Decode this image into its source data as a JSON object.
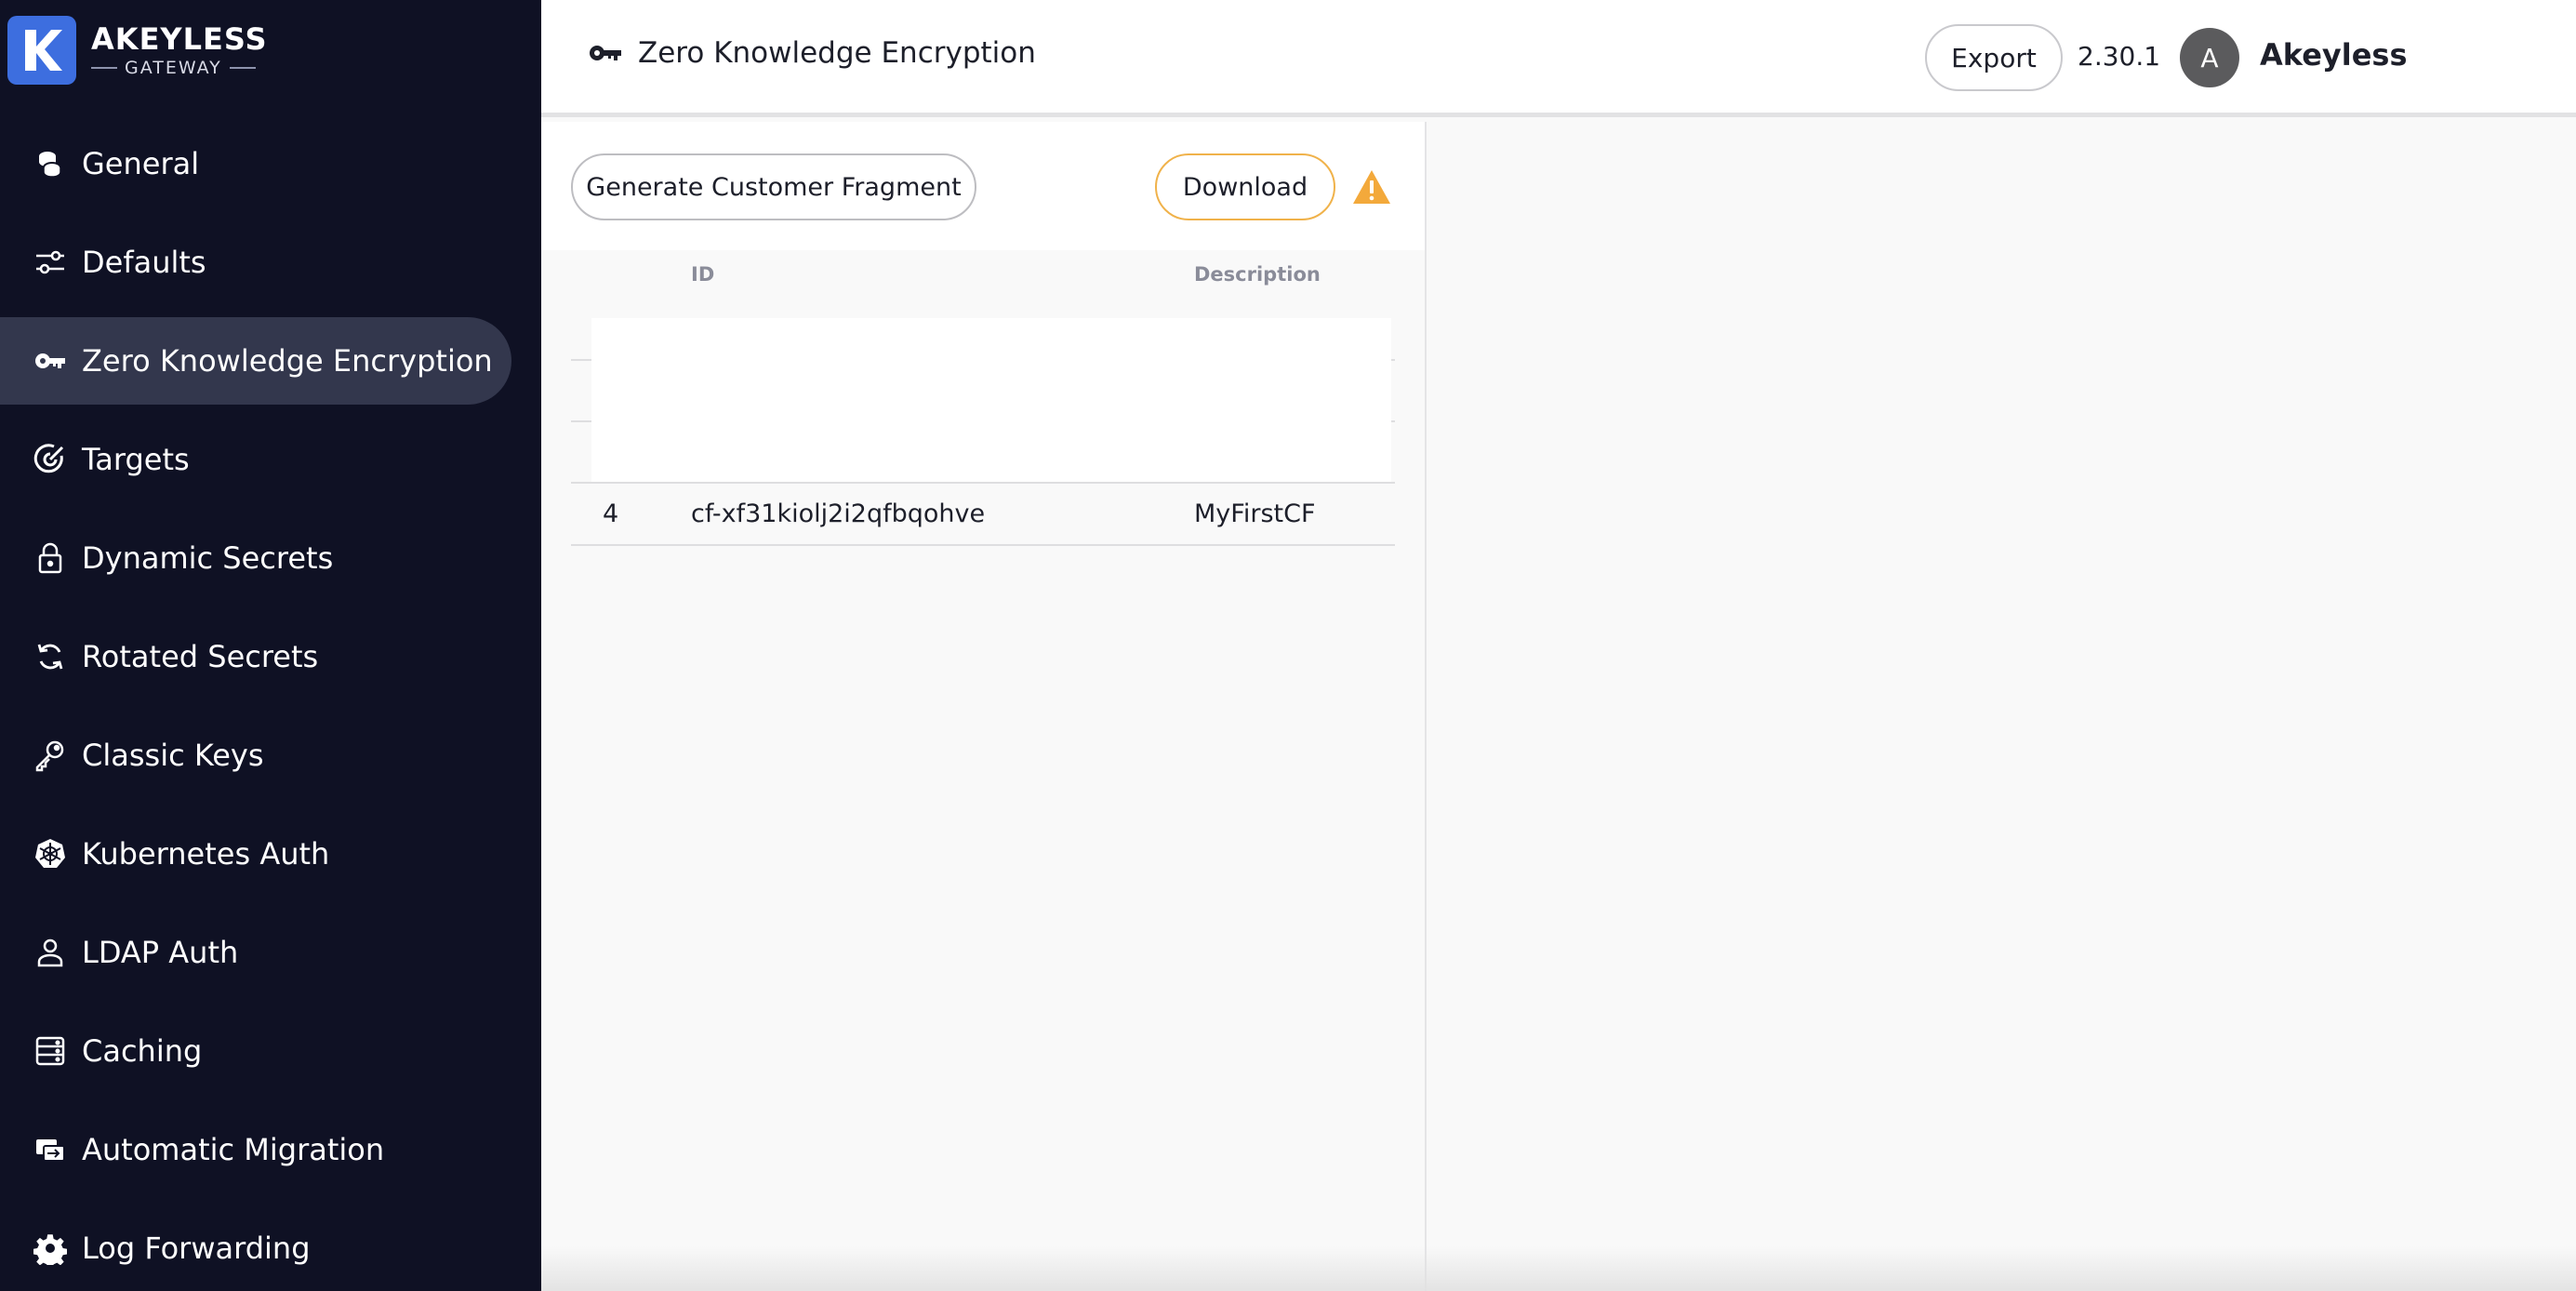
{
  "brand": {
    "name": "AKEYLESS",
    "sub": "GATEWAY",
    "logo_letter": "K"
  },
  "sidebar": {
    "items": [
      {
        "label": "General",
        "icon": "coins-icon",
        "active": false
      },
      {
        "label": "Defaults",
        "icon": "sliders-icon",
        "active": false
      },
      {
        "label": "Zero Knowledge Encryption",
        "icon": "key-icon",
        "active": true
      },
      {
        "label": "Targets",
        "icon": "target-icon",
        "active": false
      },
      {
        "label": "Dynamic Secrets",
        "icon": "lock-icon",
        "active": false
      },
      {
        "label": "Rotated Secrets",
        "icon": "rotate-icon",
        "active": false
      },
      {
        "label": "Classic Keys",
        "icon": "classic-key-icon",
        "active": false
      },
      {
        "label": "Kubernetes Auth",
        "icon": "kubernetes-icon",
        "active": false
      },
      {
        "label": "LDAP Auth",
        "icon": "user-icon",
        "active": false
      },
      {
        "label": "Caching",
        "icon": "server-icon",
        "active": false
      },
      {
        "label": "Automatic Migration",
        "icon": "migration-icon",
        "active": false
      },
      {
        "label": "Log Forwarding",
        "icon": "gear-icon",
        "active": false
      }
    ]
  },
  "header": {
    "title": "Zero Knowledge Encryption",
    "export_label": "Export",
    "version": "2.30.1",
    "avatar_letter": "A",
    "username": "Akeyless"
  },
  "toolbar": {
    "generate_label": "Generate Customer Fragment",
    "download_label": "Download"
  },
  "table": {
    "columns": [
      "ID",
      "Description"
    ],
    "rows": [
      {
        "index": "4",
        "id": "cf-xf31kiolj2i2qfbqohve",
        "description": "MyFirstCF"
      }
    ]
  },
  "colors": {
    "sidebar_bg": "#0f1124",
    "sidebar_active": "#33374d",
    "brand_blue": "#3d6edf",
    "download_border": "#f0b24a",
    "warning": "#f3a93b"
  }
}
